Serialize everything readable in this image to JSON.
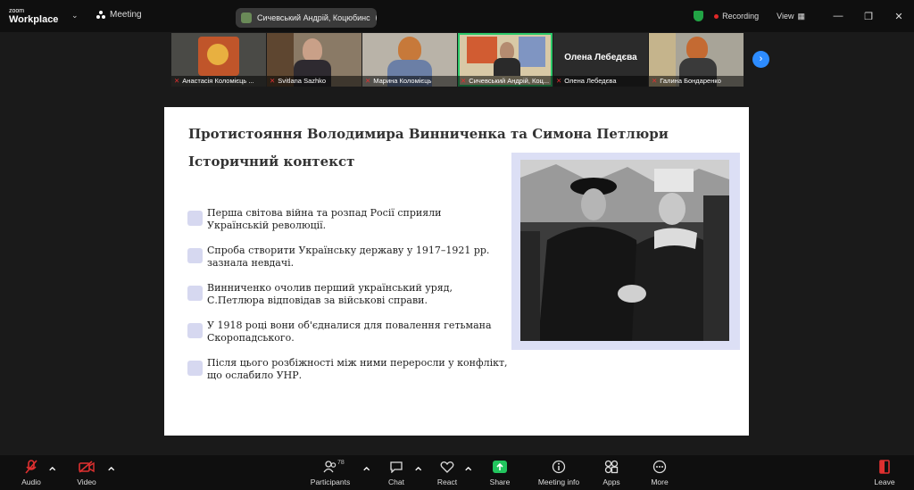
{
  "app": {
    "logo_line1": "zoom",
    "logo_line2": "Workplace"
  },
  "header": {
    "meeting_label": "Meeting",
    "speaker_pill": "Сичевський Андрій, Коцюбинс",
    "recording_label": "Recording",
    "view_label": "View"
  },
  "participants_strip": [
    {
      "name": "Анастасія Коломієць ..."
    },
    {
      "name": "Svitlana Sazhko"
    },
    {
      "name": "Марина Коломієць"
    },
    {
      "name": "Сичевський Андрій, Коц..."
    },
    {
      "name": "Олена Лебедєва",
      "big_name": "Олена Лебедєва"
    },
    {
      "name": "Галина Бондаренко"
    }
  ],
  "slide": {
    "title": "Протистояння Володимира Винниченка та Симона Петлюри",
    "subtitle": "Історичний контекст",
    "bullets": [
      {
        "line1": "Перша світова війна та розпад Росії сприяли",
        "line2": "Українській революції."
      },
      {
        "line1": "Спроба створити Українську державу у 1917–1921 рр.",
        "line2": "зазнала невдачі."
      },
      {
        "line1": "Винниченко очолив перший український уряд,",
        "line2": "С.Петлюра відповідав за військові справи."
      },
      {
        "line1": "У 1918 році вони об'єдналися для повалення гетьмана",
        "line2": "Скоропадського."
      },
      {
        "line1": "Після цього розбіжності між ними переросли у конфлікт,",
        "line2": "що ослабило УНР."
      }
    ]
  },
  "toolbar": {
    "audio": "Audio",
    "video": "Video",
    "participants": "Participants",
    "participants_count": "78",
    "chat": "Chat",
    "react": "React",
    "share": "Share",
    "meeting_info": "Meeting info",
    "apps": "Apps",
    "more": "More",
    "leave": "Leave"
  },
  "colors": {
    "accent": "#2d8cff",
    "share": "#22c55e",
    "record": "#e02828",
    "active_tile": "#2cc86a",
    "bullet_box": "#d6d8f0"
  }
}
